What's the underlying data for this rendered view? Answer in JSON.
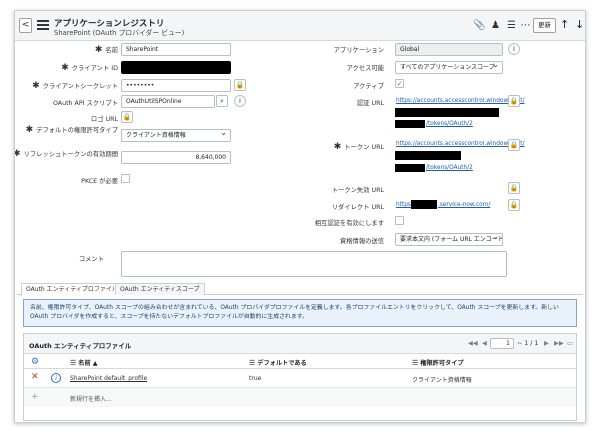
{
  "header": {
    "title": "アプリケーションレジストリ",
    "subtitle": "SharePoint (OAuth プロバイダー ビュー)",
    "update_label": "更新"
  },
  "form": {
    "name_label": "名前",
    "name_value": "SharePoint",
    "client_id_label": "クライアント ID",
    "client_secret_label": "クライアントシークレット",
    "client_secret_value": "••••••••",
    "api_script_label": "OAuth API スクリプト",
    "api_script_value": "OAuthUtilSPOnline",
    "logo_url_label": "ロゴ URL",
    "grant_type_label": "デフォルトの権限許可タイプ",
    "grant_type_value": "クライアント資格情報",
    "refresh_lifespan_label": "リフレッシュトークンの有効期間",
    "refresh_lifespan_value": "8,640,000",
    "pkce_label": "PKCE が必要",
    "application_label": "アプリケーション",
    "application_value": "Global",
    "access_label": "アクセス可能",
    "access_value": "すべてのアプリケーションスコープ",
    "active_label": "アクティブ",
    "auth_url_label": "認証 URL",
    "auth_url_1": "https://accounts.accesscontrol.windows.net/",
    "auth_url_2": "/tokens/OAuth/2",
    "token_url_label": "トークン URL",
    "token_url_1": "https://accounts.accesscontrol.windows.net/",
    "token_url_2": "/tokens/OAuth/2",
    "revoke_url_label": "トークン失効 URL",
    "redirect_url_label": "リダイレクト URL",
    "redirect_url_a": "https://",
    "redirect_url_b": ".service-now.com/",
    "mutual_auth_label": "相互認証を有効にします",
    "send_creds_label": "資格情報の送信",
    "send_creds_value": "要求本文内 (フォーム URL エンコード)",
    "comment_label": "コメント"
  },
  "tabs": [
    "OAuth エンティティプロファイル",
    "OAuth エンティティスコープ"
  ],
  "info": "名前、権限許可タイプ、OAuth スコープの組み合わせが含まれている、OAuth プロバイダプロファイルを定義します。各プロファイルエントリをクリックして、OAuth スコープを更新します。新しい OAuth プロバイダを作成すると、スコープを持たないデフォルトプロファイルが自動的に生成されます。",
  "related_list": {
    "title": "OAuth エンティティプロファイル",
    "page_value": "1",
    "page_total": "~ 1 / 1",
    "columns": [
      "名前 ▲",
      "デフォルトである",
      "権限許可タイプ"
    ],
    "rows": [
      {
        "name": "SharePoint default_profile",
        "is_default": "true",
        "grant_type": "クライアント資格情報"
      }
    ],
    "insert_label": "新規行を挿入..."
  }
}
